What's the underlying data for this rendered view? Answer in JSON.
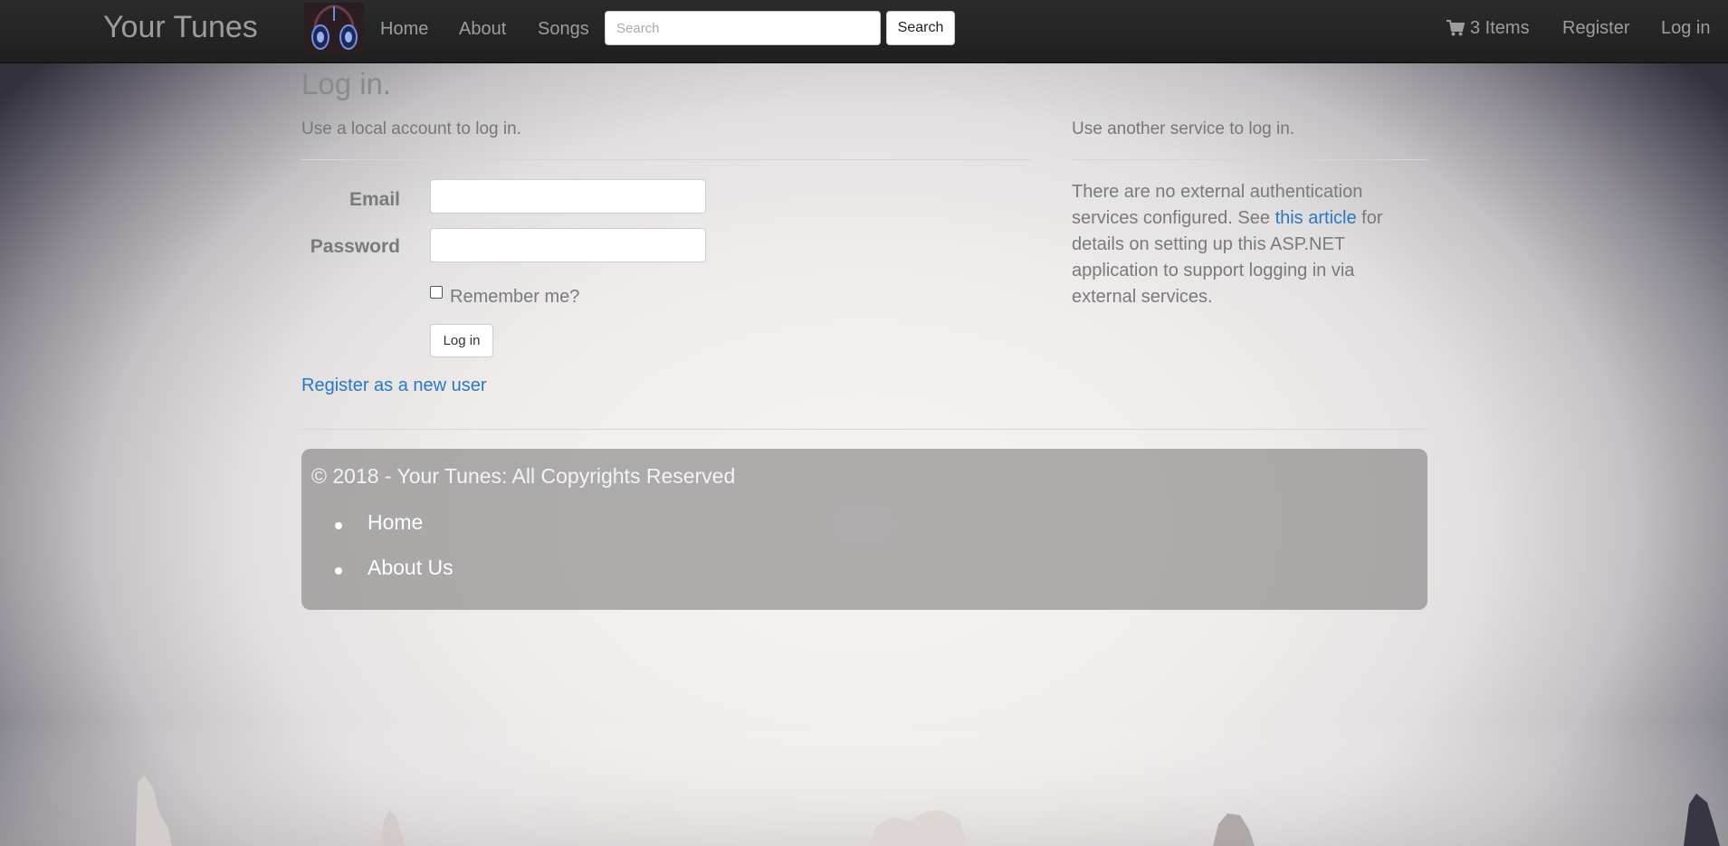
{
  "navbar": {
    "brand": "Your Tunes",
    "links": {
      "home": "Home",
      "about": "About",
      "songs": "Songs"
    },
    "search": {
      "placeholder": "Search",
      "button_label": "Search"
    },
    "cart_label": "3 Items",
    "register_label": "Register",
    "login_label": "Log in"
  },
  "main": {
    "title": "Log in.",
    "local_heading": "Use a local account to log in.",
    "form": {
      "email_label": "Email",
      "email_value": "",
      "password_label": "Password",
      "password_value": "",
      "remember_label": "Remember me?",
      "remember_checked": false,
      "submit_label": "Log in"
    },
    "register_link": "Register as a new user",
    "external": {
      "heading": "Use another service to log in.",
      "text_before": "There are no external authentication services configured. See ",
      "link_label": "this article",
      "text_after": " for details on setting up this ASP.NET application to support logging in via external services."
    }
  },
  "footer": {
    "copyright": "© 2018 - Your Tunes: All Copyrights Reserved",
    "links": [
      "Home",
      "About Us"
    ]
  },
  "colors": {
    "navbar_bg": "#222222",
    "nav_text": "#9d9d9d",
    "link": "#2a78c2",
    "footer_bg": "#8e8c8c"
  },
  "icons": [
    "headphones-logo-icon",
    "shopping-cart-icon"
  ]
}
